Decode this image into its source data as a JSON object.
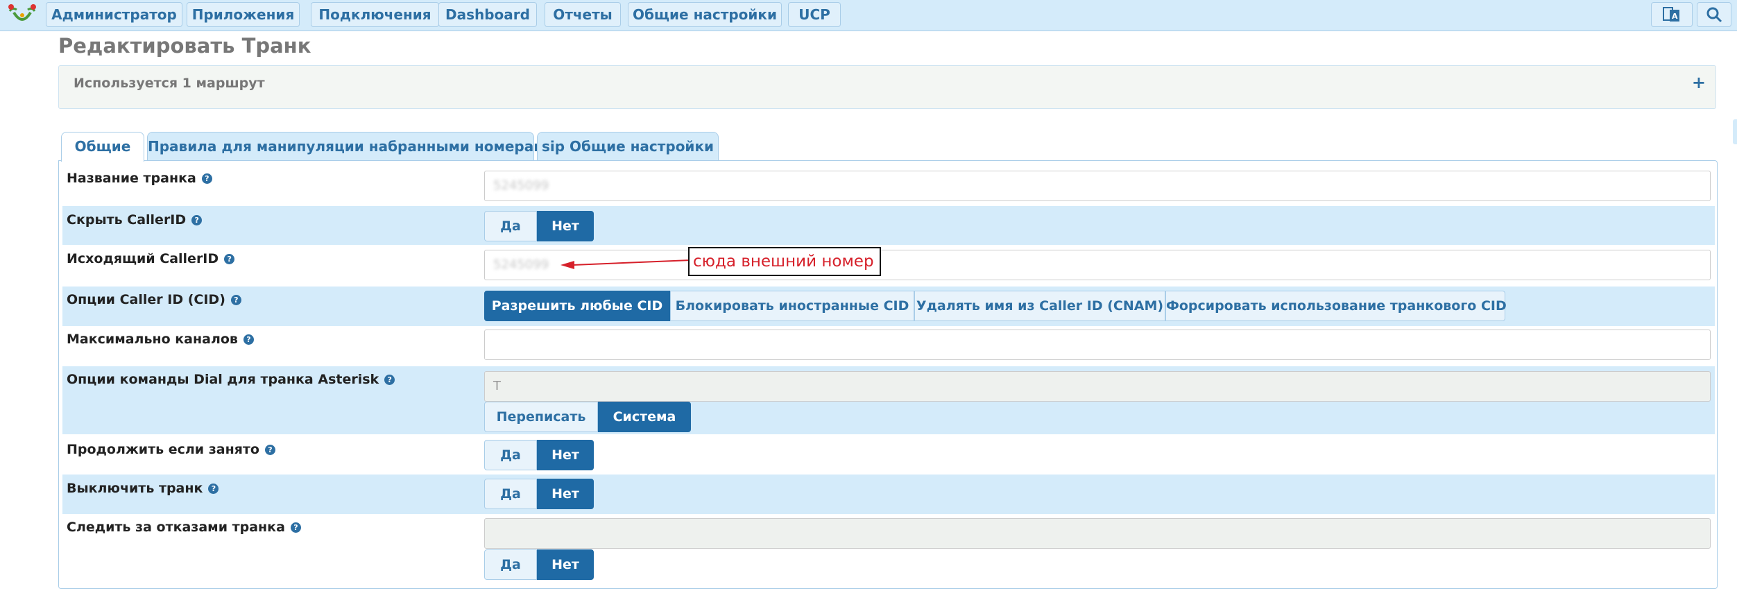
{
  "navbar": {
    "items": [
      "Администратор",
      "Приложения",
      "Подключения",
      "Dashboard",
      "Отчеты",
      "Общие настройки",
      "UCP"
    ],
    "right_icons": [
      "language-icon",
      "search-icon"
    ]
  },
  "page": {
    "title": "Редактировать Транк",
    "usage_text": "Используется 1 маршрут",
    "usage_toggle": "+"
  },
  "tabs": [
    "Общие",
    "Правила для манипуляции набранными номерами",
    "sip Общие настройки"
  ],
  "active_tab": "Общие",
  "form": {
    "trunk_name": {
      "label": "Название транка",
      "value": "5245099"
    },
    "hide_callerid": {
      "label": "Скрыть CallerID",
      "options": [
        "Да",
        "Нет"
      ],
      "selected": "Нет"
    },
    "outbound_callerid": {
      "label": "Исходящий CallerID",
      "value": "5245099"
    },
    "callerid_options": {
      "label": "Опции Caller ID (CID)",
      "options": [
        "Разрешить любые CID",
        "Блокировать иностранные CID",
        "Удалять имя из Caller ID (CNAM)",
        "Форсировать использование транкового CID"
      ],
      "selected": "Разрешить любые CID"
    },
    "max_channels": {
      "label": "Максимально каналов",
      "value": ""
    },
    "dial_options": {
      "label": "Опции команды Dial для транка Asterisk",
      "value": "T",
      "options": [
        "Переписать",
        "Система"
      ],
      "selected": "Система"
    },
    "continue_if_busy": {
      "label": "Продолжить если занято",
      "options": [
        "Да",
        "Нет"
      ],
      "selected": "Нет"
    },
    "disable_trunk": {
      "label": "Выключить транк",
      "options": [
        "Да",
        "Нет"
      ],
      "selected": "Нет"
    },
    "monitor_failures": {
      "label": "Следить за отказами транка",
      "value": "",
      "options": [
        "Да",
        "Нет"
      ],
      "selected": "Нет"
    }
  },
  "annotation": {
    "text": "сюда внешний номер",
    "color": "#d6202a"
  },
  "colors": {
    "accent": "#1f6aa5",
    "band": "#d4ebfa",
    "link": "#2d6fa3"
  }
}
